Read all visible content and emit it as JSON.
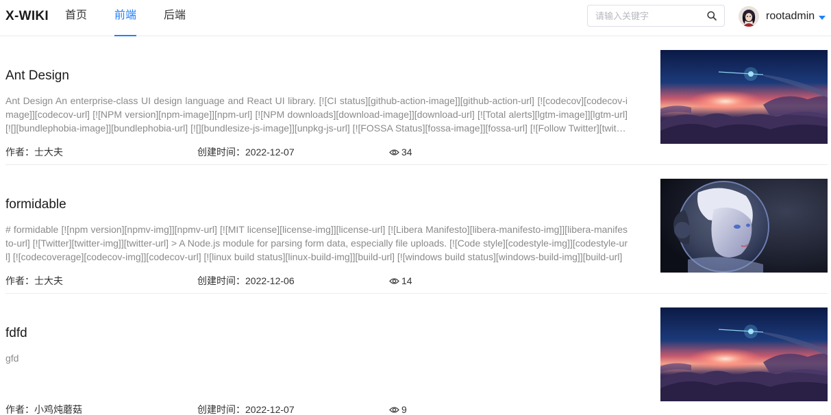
{
  "header": {
    "logo": "X-WIKI",
    "nav": [
      "首页",
      "前端",
      "后端"
    ],
    "active_nav": 1,
    "search": {
      "placeholder": "请输入关键字",
      "value": ""
    },
    "user": {
      "name": "rootadmin"
    },
    "colors": {
      "accent": "#1e80ff"
    }
  },
  "articles": [
    {
      "title": "Ant Design",
      "summary": "Ant Design An enterprise-class UI design language and React UI library. [![CI status][github-action-image]][github-action-url] [![codecov][codecov-image]][codecov-url] [![NPM version][npm-image]][npm-url] [![NPM downloads][download-image]][download-url] [![Total alerts][lgtm-image]][lgtm-url] [![][bundlephobia-image]][bundlephobia-url] [![][bundlesize-js-image]][unpkg-js-url] [![FOSSA Status][fossa-image]][fossa-url] [![Follow Twitter][twitter-image]][twitter-url]",
      "author": "作者：士大夫",
      "created": "创建时间：2022-12-07",
      "views": "34",
      "image": "sunset-clouds"
    },
    {
      "title": "formidable",
      "summary": "# formidable [![npm version][npmv-img]][npmv-url] [![MIT license][license-img]][license-url] [![Libera Manifesto][libera-manifesto-img]][libera-manifesto-url] [![Twitter][twitter-img]][twitter-url] > A Node.js module for parsing form data, especially file uploads. [![Code style][codestyle-img]][codestyle-url] [![codecoverage][codecov-img]][codecov-url] [![linux build status][linux-build-img]][build-url] [![windows build status][windows-build-img]][build-url]",
      "author": "作者：士大夫",
      "created": "创建时间：2022-12-06",
      "views": "14",
      "image": "astronaut-girl"
    },
    {
      "title": "fdfd",
      "summary": "gfd",
      "author": "作者：小鸡炖蘑菇",
      "created": "创建时间：2022-12-07",
      "views": "9",
      "image": "sunset-clouds"
    }
  ]
}
